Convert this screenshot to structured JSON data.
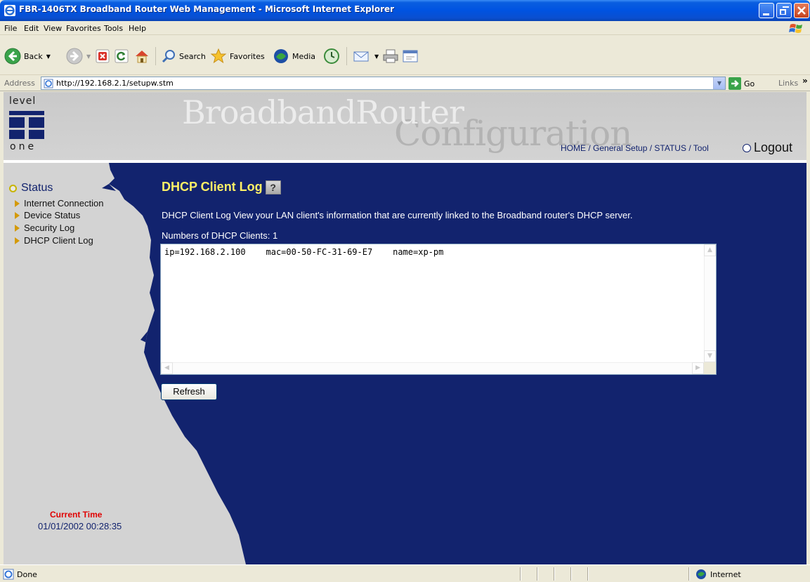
{
  "window": {
    "title": "FBR-1406TX Broadband Router Web Management - Microsoft Internet Explorer"
  },
  "menu": [
    "File",
    "Edit",
    "View",
    "Favorites",
    "Tools",
    "Help"
  ],
  "toolbar": {
    "back_label": "Back",
    "search_label": "Search",
    "favorites_label": "Favorites",
    "media_label": "Media"
  },
  "address": {
    "label": "Address",
    "url": "http://192.168.2.1/setupw.stm",
    "go_label": "Go",
    "links_label": "Links"
  },
  "header": {
    "logo_top": "level",
    "logo_bottom": "one",
    "brand_primary": "BroadbandRouter",
    "brand_secondary": "Configuration",
    "nav": {
      "home": "HOME",
      "general_setup": "General Setup",
      "status": "STATUS",
      "tool": "Tool",
      "separator": " / "
    },
    "logout": "Logout"
  },
  "sidebar": {
    "section": "Status",
    "items": [
      {
        "label": "Internet Connection"
      },
      {
        "label": "Device Status"
      },
      {
        "label": "Security Log"
      },
      {
        "label": "DHCP Client Log"
      }
    ],
    "time_label": "Current Time",
    "time_value": "01/01/2002 00:28:35"
  },
  "main": {
    "title": "DHCP Client Log",
    "description": "DHCP Client Log View your LAN client's information that are currently linked to the Broadband router's DHCP server.",
    "count_label": "Numbers of DHCP Clients:",
    "count_value": "1",
    "log_text": "ip=192.168.2.100    mac=00-50-FC-31-69-E7    name=xp-pm",
    "refresh_label": "Refresh"
  },
  "statusbar": {
    "left": "Done",
    "zone": "Internet"
  },
  "colors": {
    "page_bg": "#12236e",
    "title_yellow": "#fff066",
    "time_red": "#e00000",
    "xp_blue": "#0053e1"
  }
}
